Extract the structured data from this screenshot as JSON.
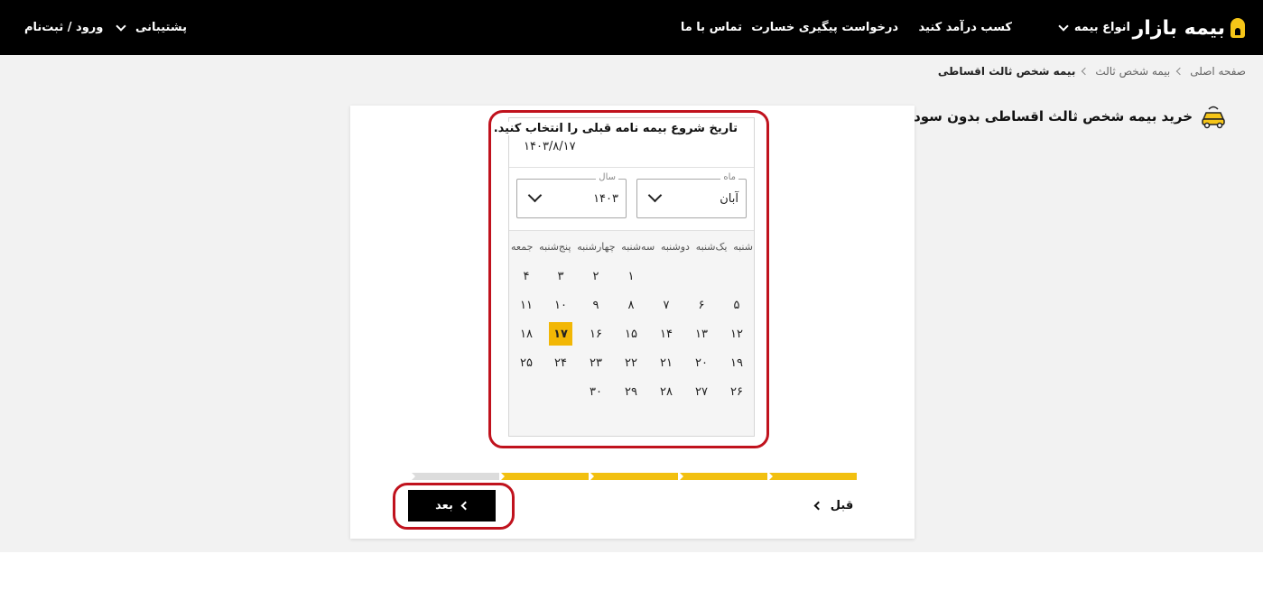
{
  "header": {
    "logo": "بیمه بازار",
    "nav": {
      "insurance_types": "انواع بیمه",
      "earn_money": "کسب درآمد کنید",
      "claim_tracking": "درخواست پیگیری خسارت",
      "contact": "تماس با ما",
      "support": "پشتیبانی",
      "login": "ورود / ثبت‌نام"
    }
  },
  "breadcrumb": [
    "صفحه اصلی",
    "بیمه شخص ثالث",
    "بیمه شخص ثالث اقساطی"
  ],
  "page_title": "خرید بیمه شخص ثالث اقساطی بدون سود",
  "picker": {
    "label": "تاریخ شروع بیمه نامه قبلی را انتخاب کنید.",
    "value": "۱۴۰۳/۸/۱۷",
    "month_legend": "ماه",
    "month_value": "آبان",
    "year_legend": "سال",
    "year_value": "۱۴۰۳",
    "weekdays": [
      "شنبه",
      "یک‌شنبه",
      "دوشنبه",
      "سه‌شنبه",
      "چهارشنبه",
      "پنج‌شنبه",
      "جمعه"
    ],
    "first_weekday_index": 3,
    "days": [
      "۱",
      "۲",
      "۳",
      "۴",
      "۵",
      "۶",
      "۷",
      "۸",
      "۹",
      "۱۰",
      "۱۱",
      "۱۲",
      "۱۳",
      "۱۴",
      "۱۵",
      "۱۶",
      "۱۷",
      "۱۸",
      "۱۹",
      "۲۰",
      "۲۱",
      "۲۲",
      "۲۳",
      "۲۴",
      "۲۵",
      "۲۶",
      "۲۷",
      "۲۸",
      "۲۹",
      "۳۰"
    ],
    "selected_day": 17
  },
  "progress": {
    "total_steps": 5,
    "completed_steps": 4,
    "accent": "#f2c010"
  },
  "buttons": {
    "next": "بعد",
    "prev": "قبل"
  },
  "colors": {
    "header_bg": "#000000",
    "accent": "#f5c518",
    "annotation": "#c0121d"
  }
}
